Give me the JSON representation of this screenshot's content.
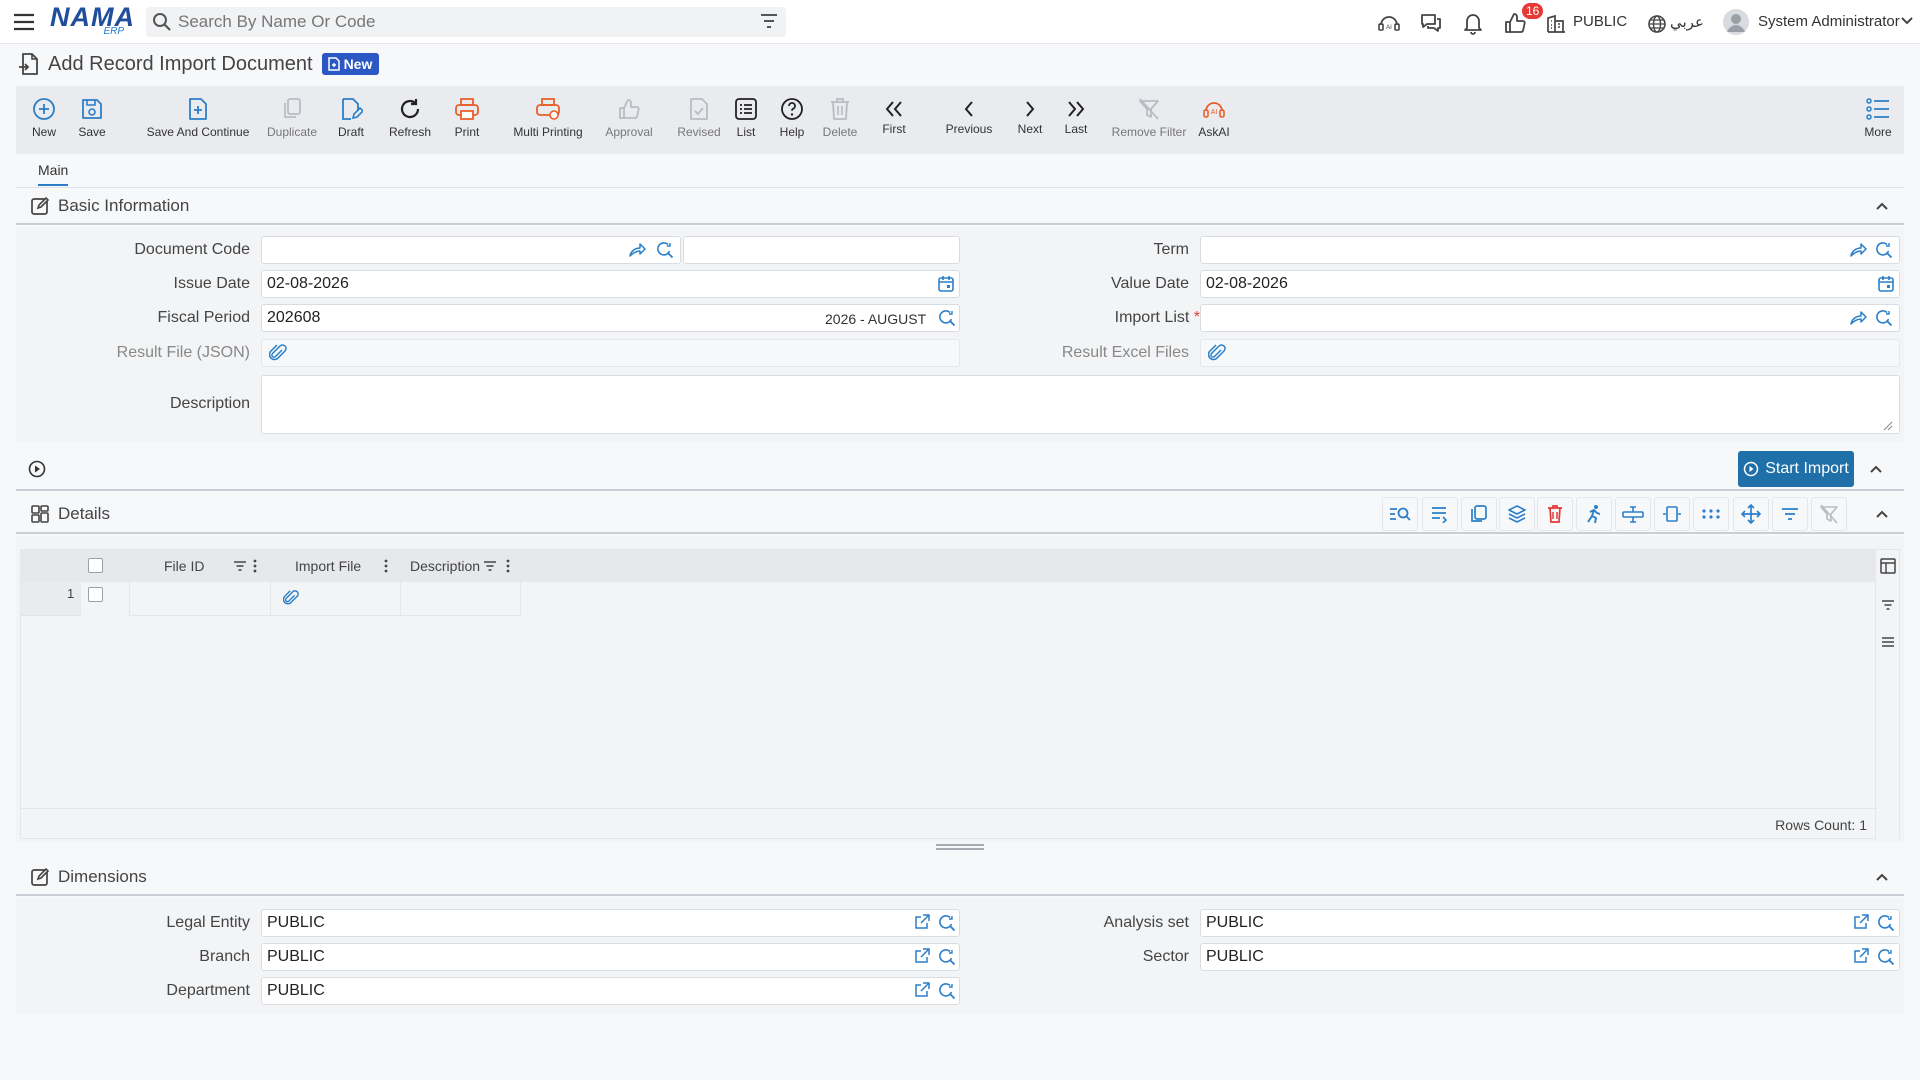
{
  "header": {
    "logo_text": "NAMA",
    "logo_sub": "ERP",
    "search_placeholder": "Search By Name Or Code",
    "notification_count": "16",
    "company": "PUBLIC",
    "language": "عربي",
    "user": "System Administrator"
  },
  "page": {
    "title": "Add Record Import Document",
    "status_badge": "New"
  },
  "toolbar": {
    "buttons": [
      {
        "label": "New",
        "icon": "plus-circle-icon"
      },
      {
        "label": "Save",
        "icon": "save-icon"
      },
      {
        "label": "Save And Continue",
        "icon": "save-continue-icon"
      },
      {
        "label": "Duplicate",
        "icon": "duplicate-icon"
      },
      {
        "label": "Draft",
        "icon": "draft-icon"
      },
      {
        "label": "Refresh",
        "icon": "refresh-icon"
      },
      {
        "label": "Print",
        "icon": "print-icon"
      },
      {
        "label": "Multi Printing",
        "icon": "multi-print-icon"
      },
      {
        "label": "Approval",
        "icon": "thumbs-up-icon"
      },
      {
        "label": "Revised",
        "icon": "revised-icon"
      },
      {
        "label": "List",
        "icon": "list-icon"
      },
      {
        "label": "Help",
        "icon": "help-icon"
      },
      {
        "label": "Delete",
        "icon": "trash-icon"
      },
      {
        "label": "First",
        "icon": "double-chevron-left-icon"
      },
      {
        "label": "Previous",
        "icon": "chevron-left-icon"
      },
      {
        "label": "Next",
        "icon": "chevron-right-icon"
      },
      {
        "label": "Last",
        "icon": "double-chevron-right-icon"
      },
      {
        "label": "Remove Filter",
        "icon": "remove-filter-icon"
      },
      {
        "label": "AskAI",
        "icon": "ai-icon"
      },
      {
        "label": "More",
        "icon": "more-list-icon"
      }
    ]
  },
  "tabs": {
    "main": "Main"
  },
  "basic_info": {
    "title": "Basic Information",
    "document_code_label": "Document Code",
    "document_code_value": "",
    "term_label": "Term",
    "term_value": "",
    "issue_date_label": "Issue Date",
    "issue_date_value": "02-08-2026",
    "value_date_label": "Value Date",
    "value_date_value": "02-08-2026",
    "fiscal_period_label": "Fiscal Period",
    "fiscal_period_value": "202608",
    "fiscal_period_name": "2026 - AUGUST",
    "import_list_label": "Import List",
    "import_list_required": "*",
    "result_file_label": "Result File (JSON)",
    "result_excel_label": "Result Excel Files",
    "description_label": "Description"
  },
  "actions": {
    "start_import": "Start Import"
  },
  "details": {
    "title": "Details",
    "columns": [
      "File ID",
      "Import File",
      "Description"
    ],
    "rows": [
      {
        "index": "1"
      }
    ],
    "rows_count_label": "Rows Count: 1"
  },
  "dimensions": {
    "title": "Dimensions",
    "legal_entity_label": "Legal Entity",
    "legal_entity_value": "PUBLIC",
    "analysis_set_label": "Analysis set",
    "analysis_set_value": "PUBLIC",
    "branch_label": "Branch",
    "branch_value": "PUBLIC",
    "sector_label": "Sector",
    "sector_value": "PUBLIC",
    "department_label": "Department",
    "department_value": "PUBLIC"
  },
  "colors": {
    "primary": "#2b7fc9",
    "brand": "#1f4e9c",
    "accent_orange": "#e8602c",
    "danger": "#e53935"
  }
}
